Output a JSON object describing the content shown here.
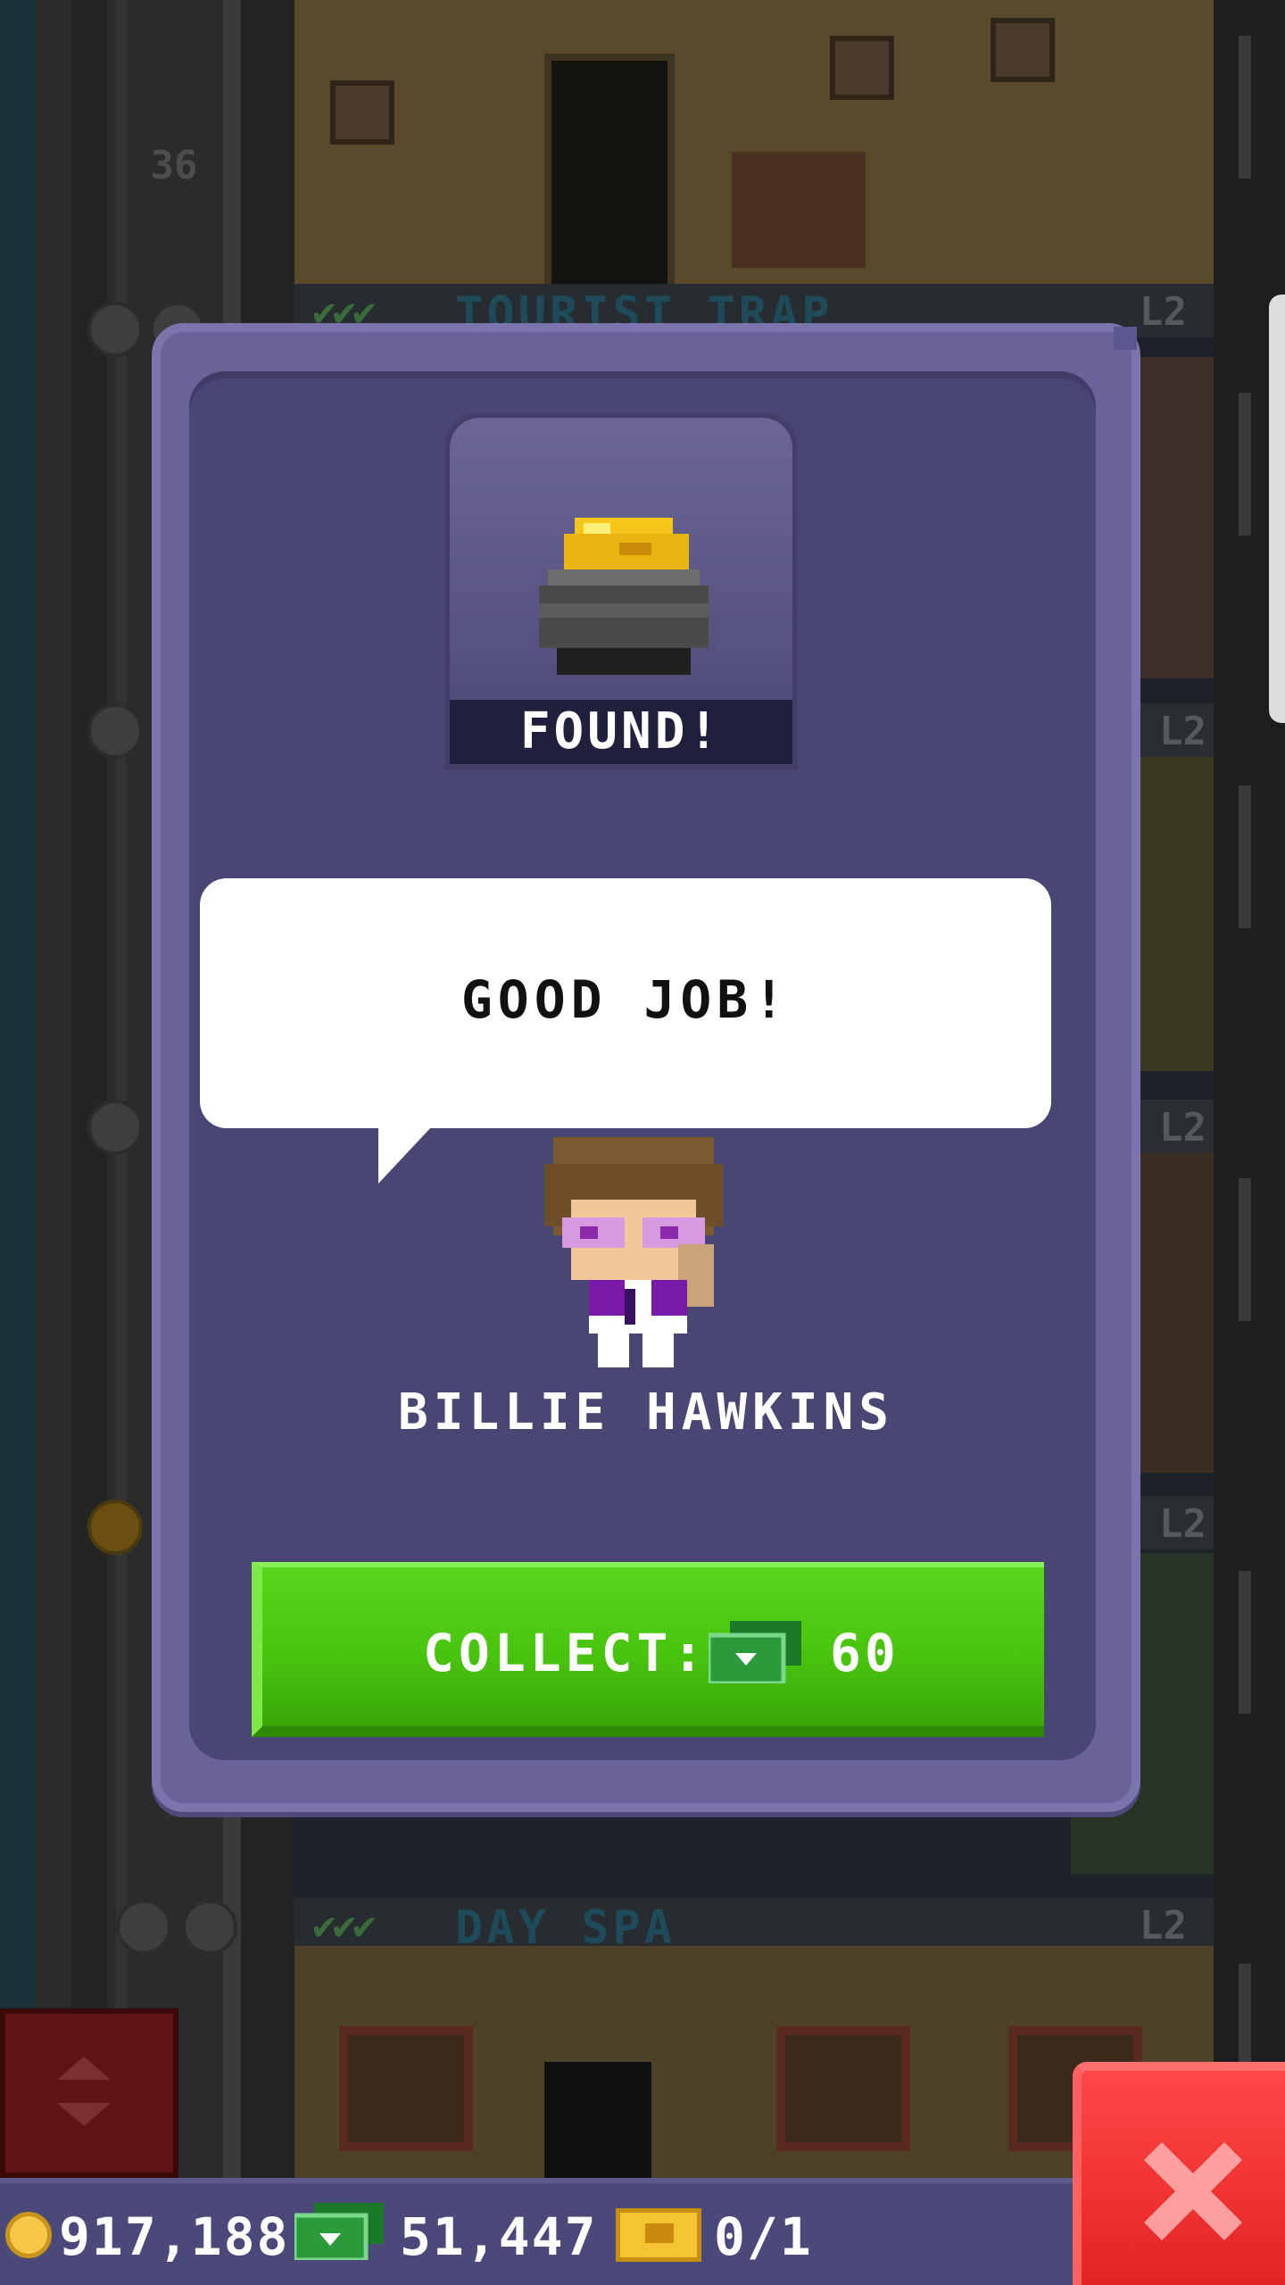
{
  "background": {
    "floor_number": "36",
    "floors": [
      {
        "name": "TOURIST TRAP",
        "level": "L2"
      },
      {
        "name": "DAY SPA",
        "level": "L2"
      }
    ],
    "side_levels": [
      "L2",
      "L2",
      "L2",
      "L2"
    ]
  },
  "modal": {
    "item_status": "FOUND!",
    "item_icon": "gold-pot-icon",
    "speech": "GOOD JOB!",
    "character_name": "BILLIE HAWKINS",
    "collect_label": "COLLECT:",
    "collect_amount": "60",
    "collect_currency_icon": "tower-bux-icon",
    "colors": {
      "collect_button": "#4ac210",
      "panel": "#4a4673"
    }
  },
  "status_bar": {
    "coins": "917,188",
    "bux": "51,447",
    "tickets": "0/1"
  },
  "close_button": {
    "icon": "close-x-icon",
    "color": "#e42323"
  }
}
